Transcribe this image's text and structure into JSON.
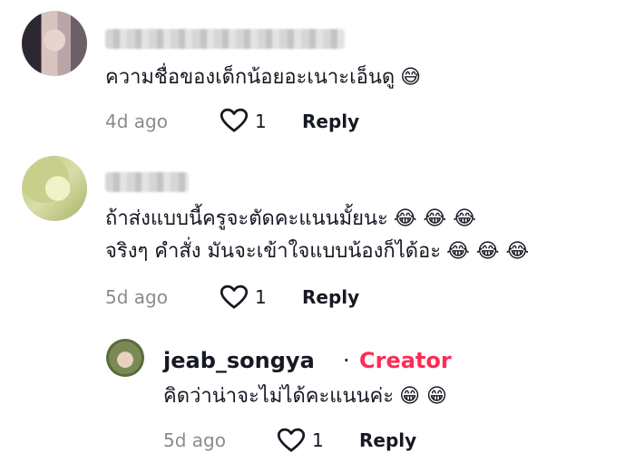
{
  "comments": [
    {
      "text": "ความชื่อของเด็กน้อยอะเนาะเอ็นดู",
      "emojis": [
        "😅"
      ],
      "time": "4d ago",
      "likes": "1",
      "reply_label": "Reply"
    },
    {
      "line1": "ถ้าส่งแบบนี้ครูจะตัดคะแนนมั้ยนะ",
      "line1_emojis": "😂 😂 😂",
      "line2": "จริงๆ คำสั่ง มันจะเข้าใจแบบน้องก็ได้อะ",
      "line2_emojis": "😂 😂 😂",
      "time": "5d ago",
      "likes": "1",
      "reply_label": "Reply"
    }
  ],
  "reply": {
    "username": "jeab_songya",
    "separator": "·",
    "badge": "Creator",
    "text": "คิดว่าน่าจะไม่ได้คะแนนค่ะ",
    "emojis": "😁 😁",
    "time": "5d ago",
    "likes": "1",
    "reply_label": "Reply"
  },
  "colors": {
    "creator": "#fe2c55",
    "meta": "#8a8b91",
    "text": "#161823"
  },
  "icons": [
    "heart-outline-icon"
  ]
}
